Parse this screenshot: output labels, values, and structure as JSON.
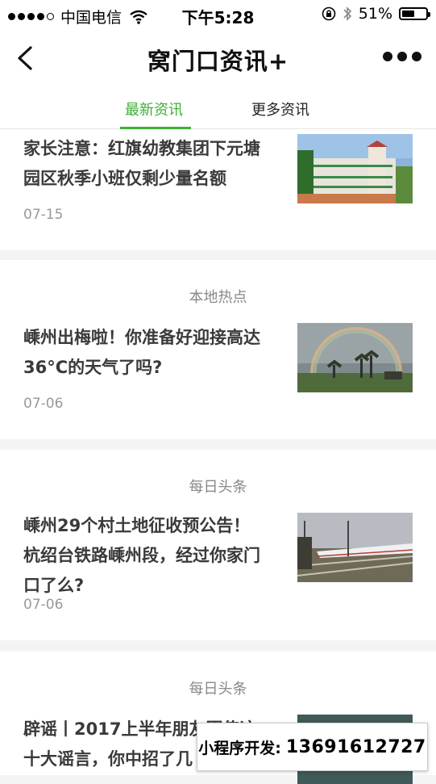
{
  "status_bar": {
    "carrier": "中国电信",
    "time": "下午5:28",
    "battery": "51%"
  },
  "nav": {
    "title": "窝门口资讯+"
  },
  "tabs": [
    {
      "label": "最新资讯",
      "active": true
    },
    {
      "label": "更多资讯",
      "active": false
    }
  ],
  "articles": [
    {
      "category": "",
      "title_lines": [
        "家长注意：红旗幼教集团下元塘",
        "园区秋季小班仅剩少量名额"
      ],
      "date": "07-15",
      "thumb": "school-building-photo"
    },
    {
      "category": "本地热点",
      "title_lines": [
        "嵊州出梅啦！你准备好迎接高达",
        "36°C的天气了吗?"
      ],
      "date": "07-06",
      "thumb": "rainbow-photo"
    },
    {
      "category": "每日头条",
      "title_lines": [
        "嵊州29个村土地征收预公告！",
        "杭绍台铁路嵊州段，经过你家门",
        "口了么?"
      ],
      "date": "07-06",
      "thumb": "train-photo"
    },
    {
      "category": "每日头条",
      "title_lines": [
        "辟谣丨2017上半年朋友圈传这",
        "十大谣言，你中招了几"
      ],
      "date": "",
      "thumb": "rumor-photo"
    }
  ],
  "watermark": {
    "label": "小程序开发:",
    "phone": "13691612727"
  },
  "colors": {
    "accent": "#3cb035",
    "background": "#f4f4f4"
  }
}
